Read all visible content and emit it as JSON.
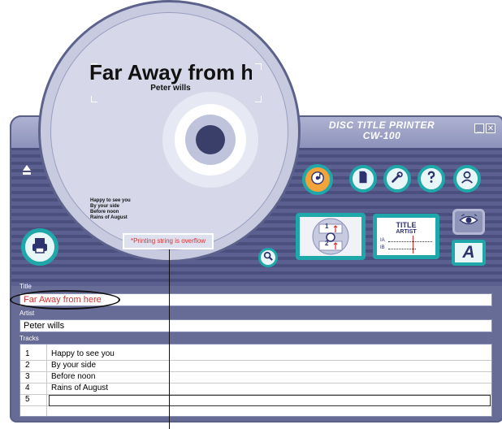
{
  "app": {
    "title_line1": "DISC TITLE PRINTER",
    "title_line2": "CW-100",
    "minimize_glyph": "_",
    "close_glyph": "✕"
  },
  "disc": {
    "title": "Far Away from h",
    "artist": "Peter wills",
    "tracks": [
      "Happy to see you",
      "By your side",
      "Before noon",
      "Rains of August"
    ],
    "warning": "*Printing string is overflow"
  },
  "toolbar": {
    "icons": [
      "music-cd-icon",
      "document-icon",
      "wrench-icon",
      "help-icon",
      "person-icon"
    ],
    "accent": "#1fa7a9",
    "active_color": "#f2a33a"
  },
  "layouts": {
    "numbers": [
      "1",
      "2"
    ],
    "title_text": "TITLE",
    "artist_text": "ARTIST",
    "row_a": "IA",
    "row_b": "IB"
  },
  "font_button": {
    "label": "A"
  },
  "form": {
    "title_label": "Title",
    "title_value": "Far Away from here",
    "artist_label": "Artist",
    "artist_value": "Peter wills",
    "tracks_label": "Tracks",
    "tracks": [
      {
        "num": "1",
        "name": "Happy to see you"
      },
      {
        "num": "2",
        "name": "By your side"
      },
      {
        "num": "3",
        "name": "Before noon"
      },
      {
        "num": "4",
        "name": "Rains of August"
      },
      {
        "num": "5",
        "name": ""
      }
    ]
  }
}
